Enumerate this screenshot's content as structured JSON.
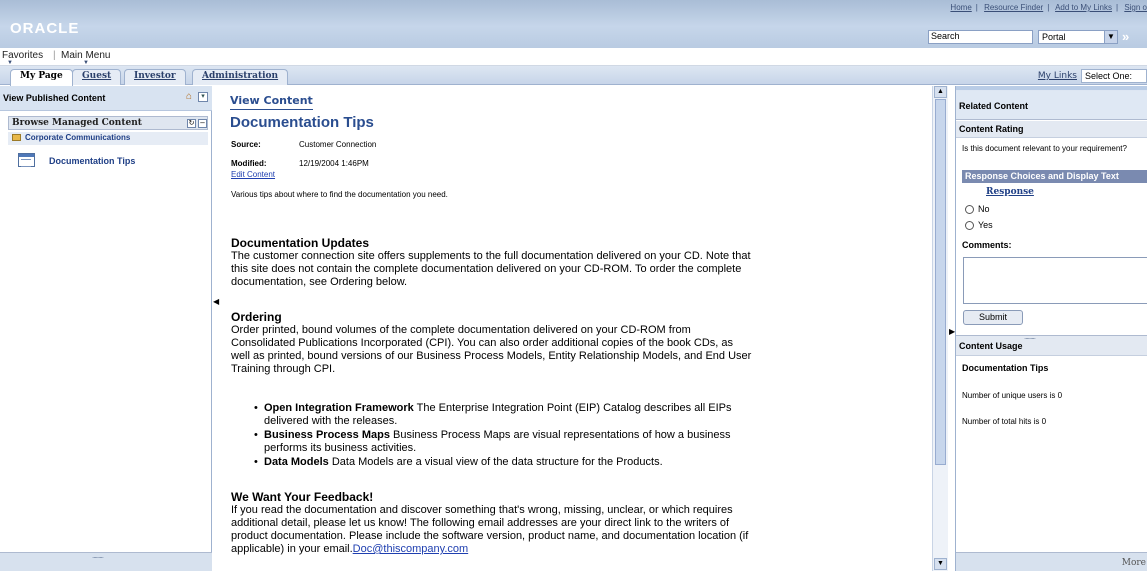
{
  "header": {
    "logo": "ORACLE",
    "links": [
      "Home",
      "Resource Finder",
      "Add to My Links",
      "Sign o"
    ],
    "search_label": "Search",
    "portal_value": "Portal",
    "go_glyph": "»"
  },
  "menubar": {
    "favorites": "Favorites",
    "main_menu": "Main Menu"
  },
  "tabs": [
    {
      "label": "My Page",
      "active": true
    },
    {
      "label": "Guest",
      "active": false
    },
    {
      "label": "Investor",
      "active": false
    },
    {
      "label": "Administration",
      "active": false
    }
  ],
  "tabbar_right": {
    "my_links": "My Links",
    "select_one": "Select One:"
  },
  "left_pane": {
    "title": "View Published Content",
    "browse_title": "Browse Managed Content",
    "folder": "Corporate Communications",
    "document": "Documentation Tips",
    "grip": "........."
  },
  "main": {
    "view_content": "View Content",
    "title": "Documentation Tips",
    "source_label": "Source:",
    "source_value": "Customer Connection",
    "modified_label": "Modified:",
    "modified_value": "12/19/2004 1:46PM",
    "edit_content": "Edit Content",
    "summary": "Various tips about where to find the documentation you need.",
    "updates_title": "Documentation Updates",
    "updates_lines": [
      "The customer connection site offers supplements to the full documentation delivered on your CD. Note that",
      "this site does not contain the complete documentation delivered on your CD-ROM. To order the complete",
      "documentation, see Ordering  below."
    ],
    "ordering_title": "Ordering",
    "ordering_lines": [
      "Order printed, bound volumes of the complete documentation delivered on your CD-ROM from",
      "Consolidated Publications Incorporated (CPI). You can also order additional copies of the book CDs, as",
      "well as printed, bound versions of our Business Process Models, Entity Relationship Models, and End User",
      "Training through CPI."
    ],
    "bullets": [
      {
        "bold": "Open Integration Framework",
        "text": "  The Enterprise Integration Point (EIP) Catalog describes all EIPs",
        "text2": "delivered with the releases."
      },
      {
        "bold": "Business Process Maps",
        "text": "  Business Process Maps are visual representations of how a business",
        "text2": "performs its business activities."
      },
      {
        "bold": "Data Models",
        "text": "  Data Models are a visual view of the data structure for the Products.",
        "text2": ""
      }
    ],
    "feedback_title": "We Want Your Feedback!",
    "feedback_lines": [
      "If you read the documentation and discover something that's wrong, missing, unclear, or which requires",
      "additional detail, please let us know! The following email addresses are your direct link to the writers of",
      "product documentation. Please include the software version, product name, and documentation location (if"
    ],
    "feedback_last": "applicable) in your email.",
    "email": "Doc@thiscompany.com"
  },
  "right_pane": {
    "title": "Related Content",
    "rating_title": "Content Rating",
    "question": "Is this document relevant to your requirement?",
    "response_header": "Response Choices and Display Text",
    "response_col": "Response",
    "options": [
      "No",
      "Yes"
    ],
    "comments_label": "Comments:",
    "submit": "Submit",
    "usage_title": "Content Usage",
    "usage_doc": "Documentation Tips",
    "unique_users": "Number of unique users is 0",
    "total_hits": "Number of total hits is 0",
    "more": "More",
    "grip": "........."
  }
}
